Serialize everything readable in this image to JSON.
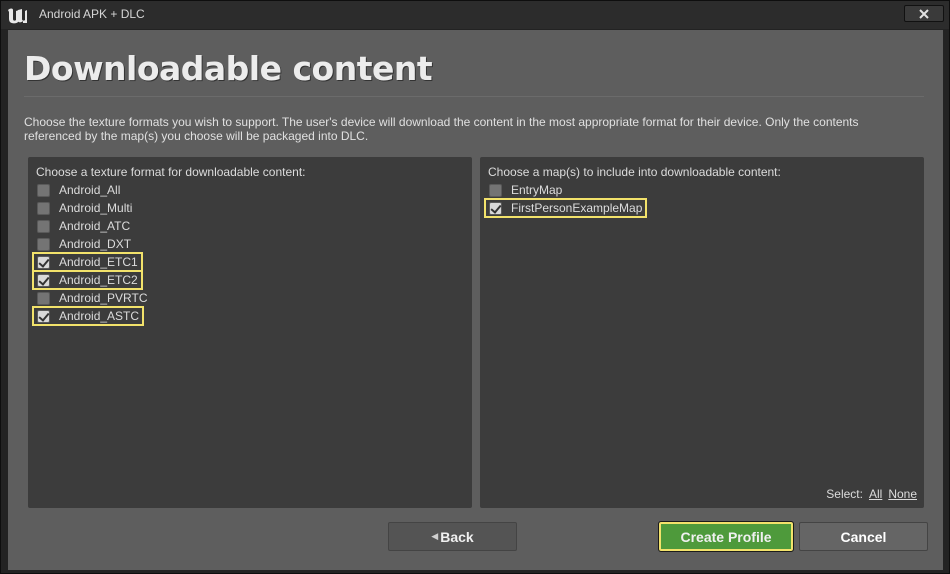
{
  "window": {
    "title": "Android APK + DLC"
  },
  "page": {
    "heading": "Downloadable content",
    "intro": "Choose the texture formats you wish to support. The user's device will download the content in the most appropriate format for their device. Only the contents referenced by the map(s) you choose will be packaged into DLC."
  },
  "texture_panel": {
    "label": "Choose a texture format for downloadable content:",
    "items": [
      {
        "label": "Android_All",
        "checked": false
      },
      {
        "label": "Android_Multi",
        "checked": false
      },
      {
        "label": "Android_ATC",
        "checked": false
      },
      {
        "label": "Android_DXT",
        "checked": false
      },
      {
        "label": "Android_ETC1",
        "checked": true
      },
      {
        "label": "Android_ETC2",
        "checked": true
      },
      {
        "label": "Android_PVRTC",
        "checked": false
      },
      {
        "label": "Android_ASTC",
        "checked": true
      }
    ]
  },
  "map_panel": {
    "label": "Choose a map(s) to include into downloadable content:",
    "items": [
      {
        "label": "EntryMap",
        "checked": false
      },
      {
        "label": "FirstPersonExampleMap",
        "checked": true
      }
    ],
    "select_label": "Select:",
    "select_all": "All",
    "select_none": "None"
  },
  "buttons": {
    "back": "Back",
    "create_profile": "Create Profile",
    "cancel": "Cancel"
  },
  "colors": {
    "accent_highlight": "#f2e26b",
    "primary_button": "#4e9a3b",
    "content_bg": "#5e5e5e",
    "panel_bg": "#3c3c3c"
  }
}
